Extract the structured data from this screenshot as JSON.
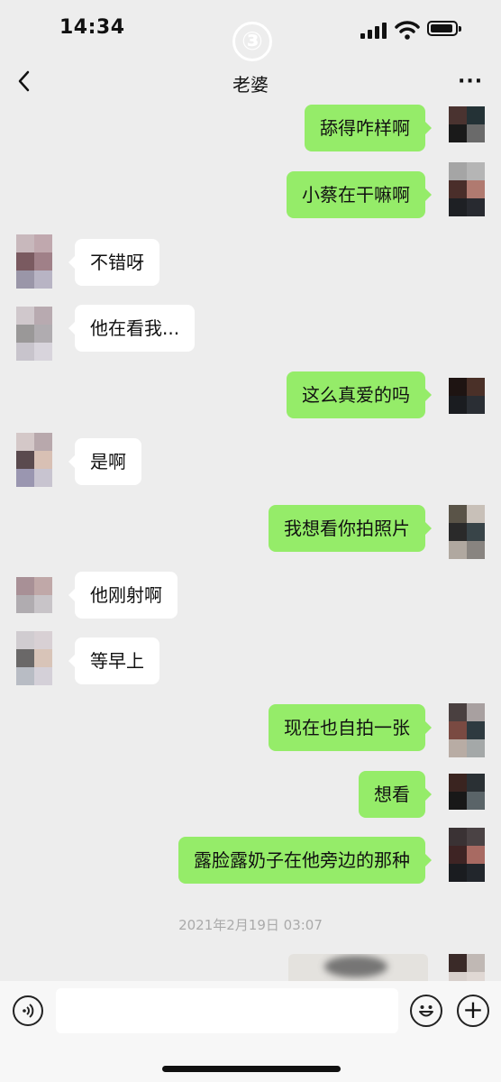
{
  "status": {
    "time": "14:34",
    "overlay_mark": "③"
  },
  "header": {
    "title": "老婆",
    "more": "···"
  },
  "messages": [
    {
      "side": "me",
      "text": "舔得咋样啊"
    },
    {
      "side": "me",
      "text": "小蔡在干嘛啊"
    },
    {
      "side": "them",
      "text": "不错呀"
    },
    {
      "side": "them",
      "text": "他在看我..."
    },
    {
      "side": "me",
      "text": "这么真爱的吗"
    },
    {
      "side": "them",
      "text": "是啊"
    },
    {
      "side": "me",
      "text": "我想看你拍照片"
    },
    {
      "side": "them",
      "text": "他刚射啊"
    },
    {
      "side": "them",
      "text": "等早上"
    },
    {
      "side": "me",
      "text": "现在也自拍一张"
    },
    {
      "side": "me",
      "text": "想看"
    },
    {
      "side": "me",
      "text": "露脸露奶子在他旁边的那种"
    }
  ],
  "timestamp": "2021年2月19日 03:07",
  "input_bar": {
    "voice_icon": "voice-icon",
    "emoji_icon": "emoji-icon",
    "plus_icon": "plus-icon"
  },
  "colors": {
    "my_bubble": "#95ec69",
    "their_bubble": "#ffffff",
    "background": "#ededed"
  }
}
